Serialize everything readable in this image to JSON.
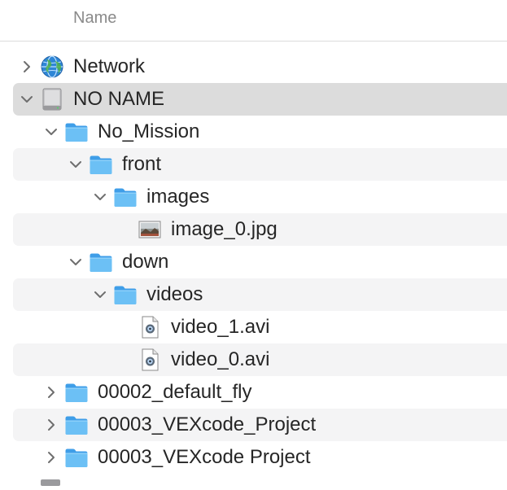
{
  "header": {
    "name_column": "Name"
  },
  "rows": [
    {
      "label": "Network"
    },
    {
      "label": "NO NAME"
    },
    {
      "label": "No_Mission"
    },
    {
      "label": "front"
    },
    {
      "label": "images"
    },
    {
      "label": "image_0.jpg"
    },
    {
      "label": "down"
    },
    {
      "label": "videos"
    },
    {
      "label": "video_1.avi"
    },
    {
      "label": "video_0.avi"
    },
    {
      "label": "00002_default_fly"
    },
    {
      "label": "00003_VEXcode_Project"
    },
    {
      "label": "00003_VEXcode Project"
    }
  ],
  "colors": {
    "folder": "#5ab3f0",
    "selection": "#dcdcdc",
    "stripe": "#f4f4f5"
  }
}
